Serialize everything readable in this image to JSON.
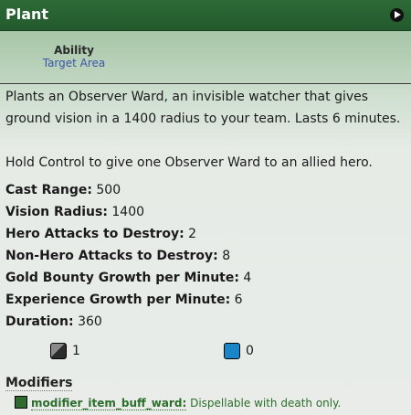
{
  "title": "Plant",
  "ability": {
    "label": "Ability",
    "value": "Target Area"
  },
  "description": [
    "Plants an Observer Ward, an invisible watcher that gives ground vision in a 1400 radius to your team. Lasts 6 minutes.",
    "Hold Control to give one Observer Ward to an allied hero."
  ],
  "stats": [
    {
      "label": "Cast Range:",
      "value": "500"
    },
    {
      "label": "Vision Radius:",
      "value": "1400"
    },
    {
      "label": "Hero Attacks to Destroy:",
      "value": "2"
    },
    {
      "label": "Non-Hero Attacks to Destroy:",
      "value": "8"
    },
    {
      "label": "Gold Bounty Growth per Minute:",
      "value": "4"
    },
    {
      "label": "Experience Growth per Minute:",
      "value": "6"
    },
    {
      "label": "Duration:",
      "value": "360"
    }
  ],
  "costs": [
    {
      "icon": "cooldown-icon",
      "value": "1",
      "color": "#2c2c2c"
    },
    {
      "icon": "mana-icon",
      "value": "0",
      "color": "#1a86c8"
    }
  ],
  "modifiers": {
    "header": "Modifiers",
    "items": [
      {
        "name": "modifier_item_buff_ward:",
        "description": "Dispellable with death only."
      }
    ]
  },
  "colors": {
    "title_bar": "#2d6a37",
    "modifier_text": "#2b6e2b",
    "link_blue": "#3a55a8"
  }
}
